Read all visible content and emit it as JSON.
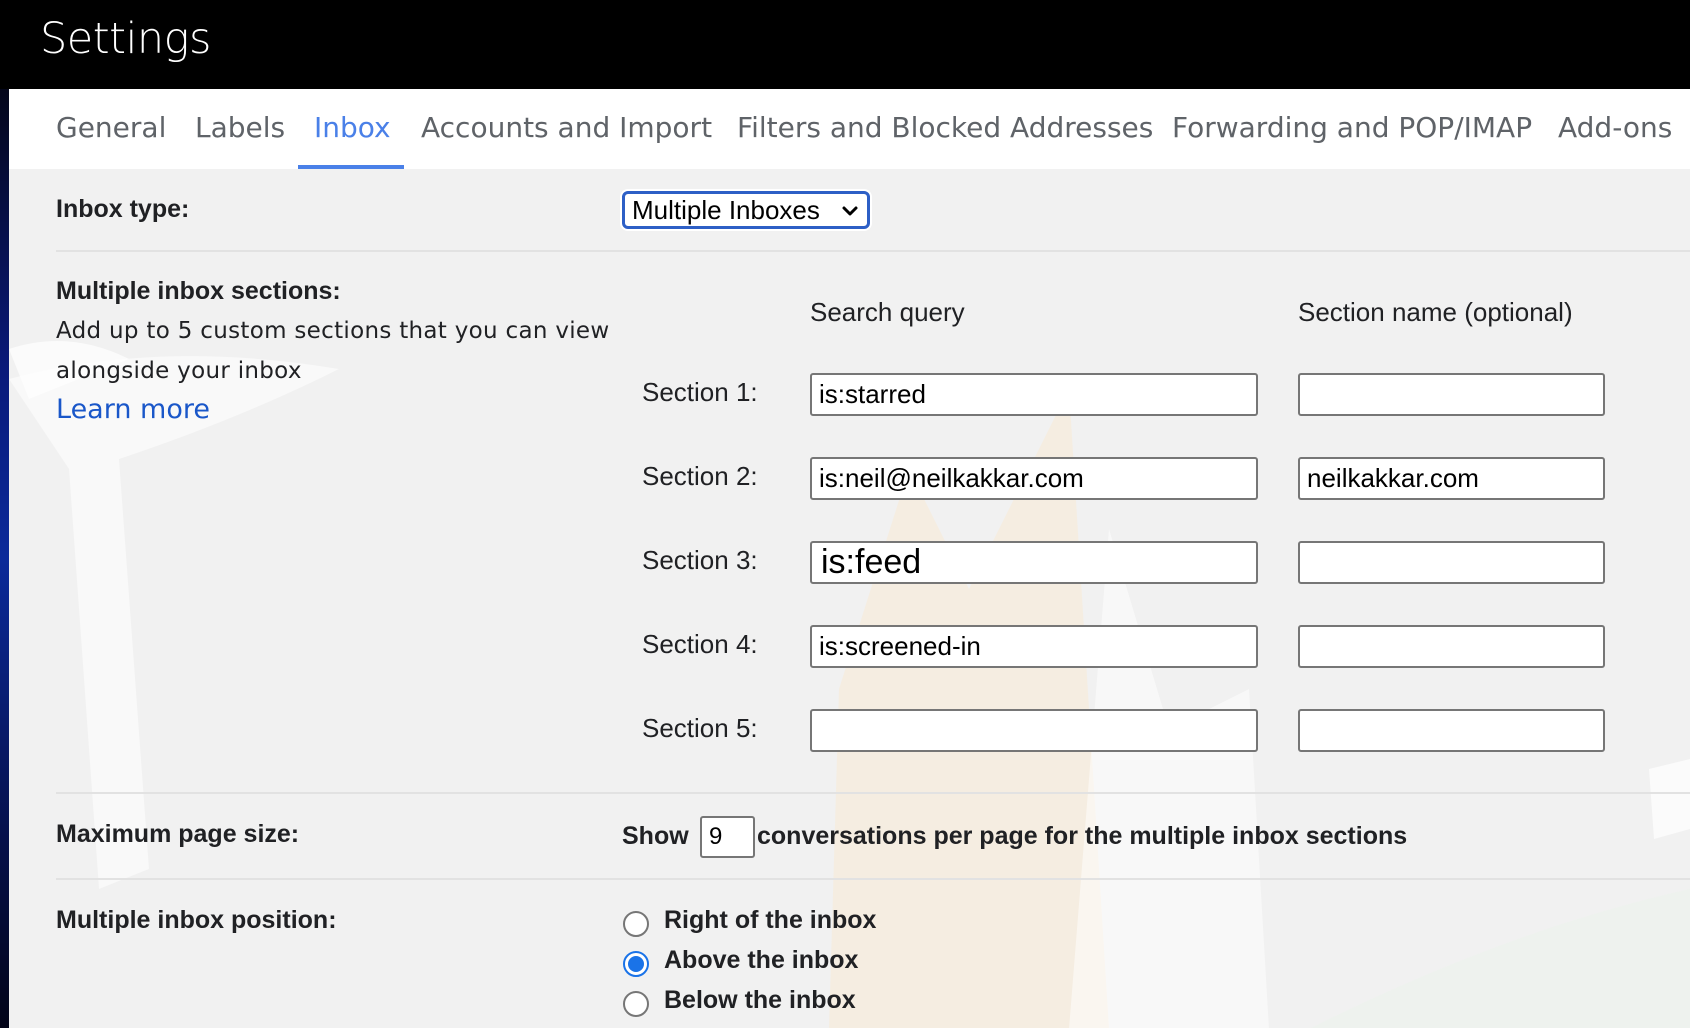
{
  "header": {
    "title": "Settings"
  },
  "tabs": [
    {
      "label": "General",
      "active": false
    },
    {
      "label": "Labels",
      "active": false
    },
    {
      "label": "Inbox",
      "active": true
    },
    {
      "label": "Accounts and Import",
      "active": false
    },
    {
      "label": "Filters and Blocked Addresses",
      "active": false
    },
    {
      "label": "Forwarding and POP/IMAP",
      "active": false
    },
    {
      "label": "Add-ons",
      "active": false
    }
  ],
  "inbox_type": {
    "label": "Inbox type:",
    "selected": "Multiple Inboxes",
    "icon": "chevron-down-icon"
  },
  "multiple_sections": {
    "title": "Multiple inbox sections:",
    "description_line1": "Add up to 5 custom sections that you can view",
    "description_line2": "alongside your inbox",
    "learn_more": "Learn more",
    "col_query": "Search query",
    "col_name": "Section name (optional)",
    "rows": [
      {
        "label": "Section 1:",
        "query": "is:starred",
        "name": ""
      },
      {
        "label": "Section 2:",
        "query": "is:neil@neilkakkar.com",
        "name": "neilkakkar.com"
      },
      {
        "label": "Section 3:",
        "query": "is:feed",
        "name": ""
      },
      {
        "label": "Section 4:",
        "query": "is:screened-in",
        "name": ""
      },
      {
        "label": "Section 5:",
        "query": "",
        "name": ""
      }
    ]
  },
  "page_size": {
    "label": "Maximum page size:",
    "prefix": "Show",
    "value": "9",
    "suffix": "conversations per page for the multiple inbox sections"
  },
  "position": {
    "label": "Multiple inbox position:",
    "options": [
      {
        "label": "Right of the inbox",
        "checked": false
      },
      {
        "label": "Above the inbox",
        "checked": true
      },
      {
        "label": "Below the inbox",
        "checked": false
      }
    ]
  },
  "colors": {
    "accent": "#4a80e8",
    "link": "#1a57c9",
    "radio": "#1a73e8",
    "panel": "#f1f1f1"
  }
}
